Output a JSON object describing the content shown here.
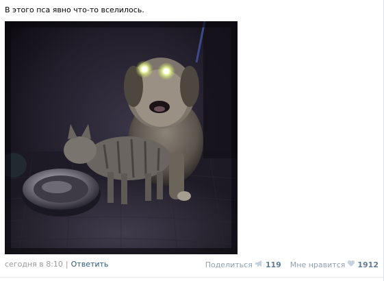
{
  "post": {
    "text": "В этого пса явно что-то вселилось.",
    "photo": {
      "subject": "dog-with-glowing-eyes-and-cat"
    }
  },
  "footer": {
    "date": "сегодня в 8:10",
    "divider": "|",
    "reply_label": "Ответить",
    "share": {
      "label": "Поделиться",
      "icon": "megaphone-icon",
      "count": "119"
    },
    "like": {
      "label": "Мне нравится",
      "icon": "heart-icon",
      "count": "1912"
    }
  },
  "colors": {
    "link": "#2b587a",
    "muted": "#999999",
    "action_label": "#8fa1b3",
    "action_count": "#5e7b99",
    "icon": "#c5d2dd"
  }
}
